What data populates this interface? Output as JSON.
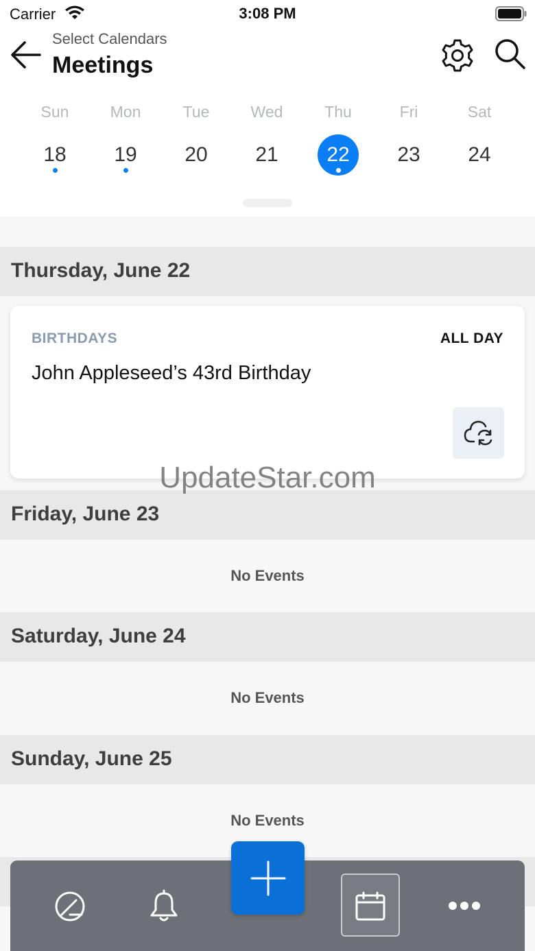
{
  "status_bar": {
    "carrier": "Carrier",
    "time": "3:08 PM"
  },
  "header": {
    "subtitle": "Select Calendars",
    "title": "Meetings"
  },
  "week": {
    "days": [
      {
        "name": "Sun",
        "num": "18",
        "has_event": true,
        "selected": false
      },
      {
        "name": "Mon",
        "num": "19",
        "has_event": true,
        "selected": false
      },
      {
        "name": "Tue",
        "num": "20",
        "has_event": false,
        "selected": false
      },
      {
        "name": "Wed",
        "num": "21",
        "has_event": false,
        "selected": false
      },
      {
        "name": "Thu",
        "num": "22",
        "has_event": true,
        "selected": true
      },
      {
        "name": "Fri",
        "num": "23",
        "has_event": false,
        "selected": false
      },
      {
        "name": "Sat",
        "num": "24",
        "has_event": false,
        "selected": false
      }
    ]
  },
  "sections": [
    {
      "label": "Thursday, June 22"
    },
    {
      "label": "Friday, June 23",
      "no_events": "No Events"
    },
    {
      "label": "Saturday, June 24",
      "no_events": "No Events"
    },
    {
      "label": "Sunday, June 25",
      "no_events": "No Events"
    }
  ],
  "event": {
    "category": "BIRTHDAYS",
    "time": "ALL DAY",
    "title": "John Appleseed’s 43rd Birthday",
    "action_icon": "cloud-sync-icon"
  },
  "watermark": "UpdateStar.com",
  "tab_bar": {
    "items": [
      "dashboard-icon",
      "bell-icon",
      "add-icon",
      "calendar-icon",
      "more-icon"
    ]
  },
  "colors": {
    "accent": "#0a7ef5",
    "fab": "#0a6fd6",
    "tab_bar": "#6e7078"
  }
}
